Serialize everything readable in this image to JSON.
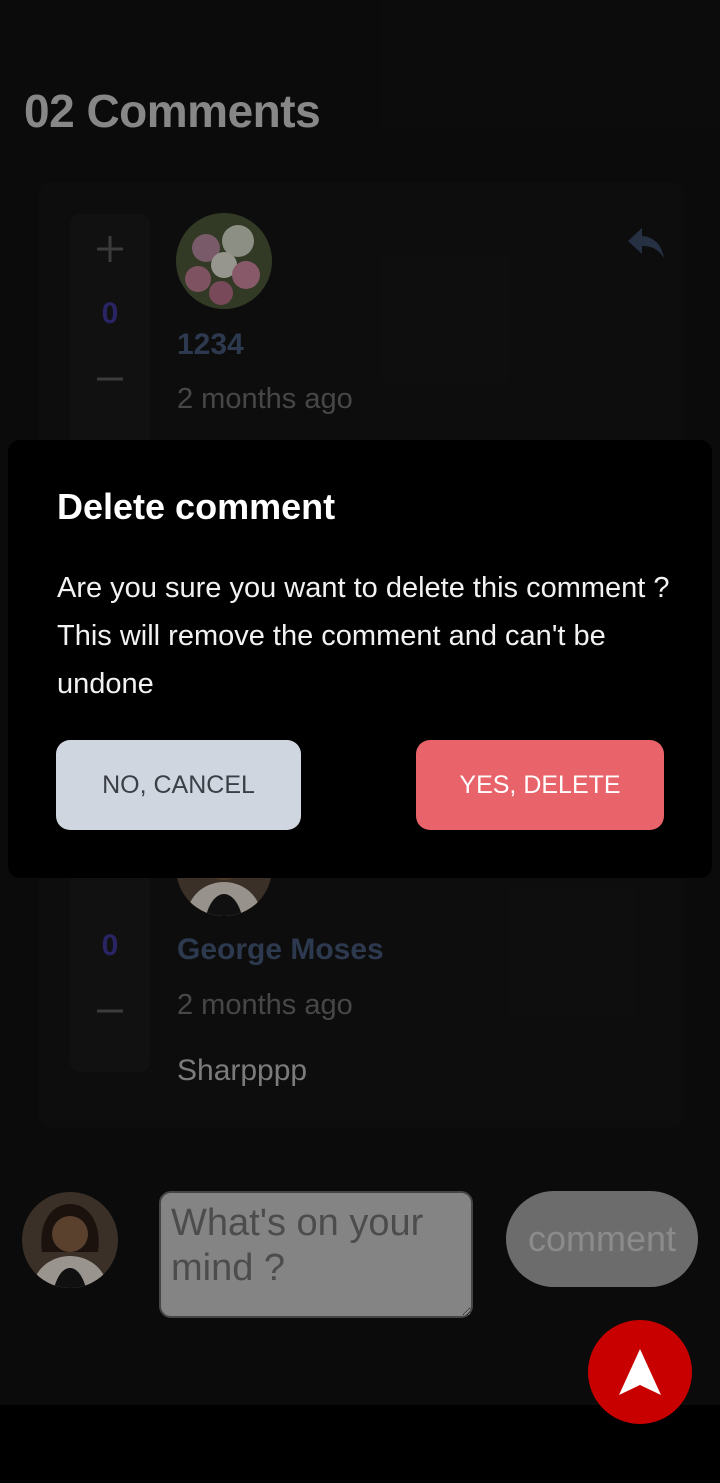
{
  "header": {
    "title": "02 Comments"
  },
  "comments": [
    {
      "vote_count": "0",
      "username": "1234",
      "time": "2 months ago",
      "avatar_icon": "flower-avatar"
    },
    {
      "vote_count": "0",
      "username": "George Moses",
      "time": "2 months ago",
      "text": "Sharpppp",
      "avatar_icon": "person-avatar"
    }
  ],
  "dialog": {
    "title": "Delete comment",
    "message": "Are you sure you want to delete this comment ? This will remove the comment and can't be undone",
    "cancel_label": "NO, CANCEL",
    "delete_label": "YES, DELETE"
  },
  "composer": {
    "placeholder": "What's on your mind ?",
    "button_label": "comment"
  },
  "colors": {
    "delete": "#e8636a",
    "cancel": "#cfd6e0",
    "fab": "#c80000",
    "username": "#46587a",
    "vote_count": "#3f3a9a"
  }
}
